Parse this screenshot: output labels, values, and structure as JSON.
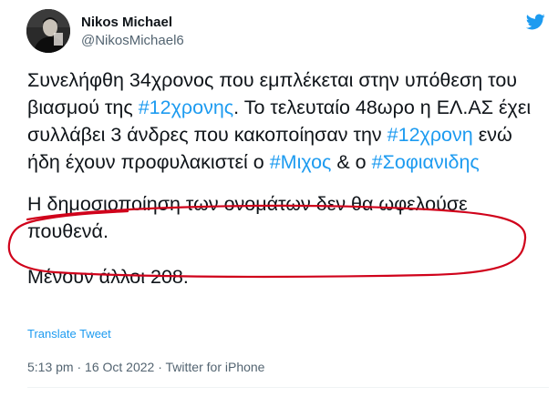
{
  "author": {
    "name": "Nikos Michael",
    "handle": "@NikosMichael6"
  },
  "tweet": {
    "p1": {
      "t1": "Συνελήφθη 34χρονος που εμπλέκεται στην υπόθεση του βιασμού της ",
      "h1": "#12χρονης",
      "t2": ". Το τελευταίο 48ωρο η ΕΛ.ΑΣ έχει συλλάβει 3 άνδρες που κακοποίησαν την ",
      "h2": "#12χρονη",
      "t3": " ενώ ήδη έχουν προφυλακιστεί ο ",
      "h3": "#Μιχος",
      "t4": " & ο ",
      "h4": "#Σοφιανιδης"
    },
    "p2": "Η δημοσιοποίηση των ονομάτων δεν θα ωφελούσε πουθενά.",
    "p3": "Μένουν άλλοι 208."
  },
  "translate_label": "Translate Tweet",
  "meta": {
    "time": "5:13 pm",
    "date": "16 Oct 2022",
    "source": "Twitter for iPhone",
    "separator": " · "
  },
  "colors": {
    "accent": "#1d9bf0",
    "annotation": "#d0021b"
  },
  "icons": {
    "logo": "twitter-bird-icon"
  }
}
